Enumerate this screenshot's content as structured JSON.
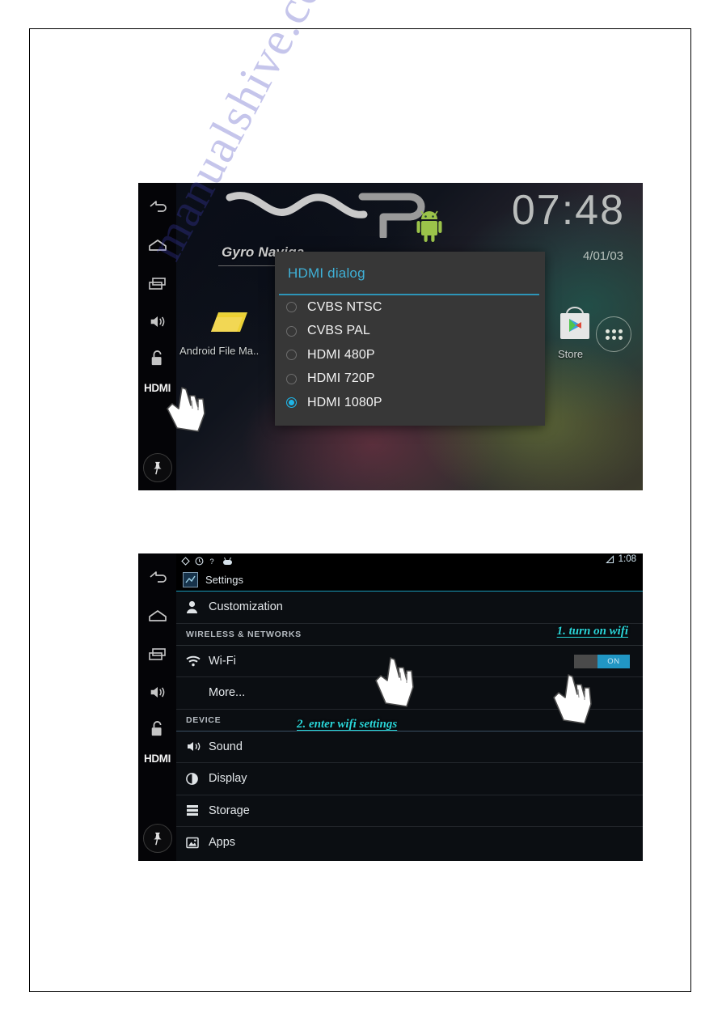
{
  "watermark": {
    "text": "manualshive.com"
  },
  "screenshot_home": {
    "name": "android-home-screen-with-hdmi-dialog",
    "nav_rail": {
      "items": [
        {
          "name": "back",
          "icon": "back-arrow-icon"
        },
        {
          "name": "home",
          "icon": "home-icon"
        },
        {
          "name": "recents",
          "icon": "recents-icon"
        },
        {
          "name": "volume",
          "icon": "volume-icon"
        },
        {
          "name": "lock",
          "icon": "unlock-icon"
        },
        {
          "name": "hdmi",
          "label": "HDMI"
        },
        {
          "name": "pin",
          "icon": "pin-icon"
        }
      ]
    },
    "brand_logo": "WP",
    "widget_title": "Gyro Naviga",
    "clock": "07:48",
    "date": "4/01/03",
    "apps": [
      {
        "label": "Android File Ma..",
        "icon": "file-manager-icon"
      },
      {
        "label": "Store",
        "icon": "play-store-icon"
      }
    ],
    "drawer_button": "app-drawer-icon",
    "dialog": {
      "title": "HDMI dialog",
      "options": [
        {
          "label": "CVBS NTSC",
          "selected": false
        },
        {
          "label": "CVBS PAL",
          "selected": false
        },
        {
          "label": "HDMI 480P",
          "selected": false
        },
        {
          "label": "HDMI 720P",
          "selected": false
        },
        {
          "label": "HDMI 1080P",
          "selected": true
        }
      ],
      "accent_color": "#2d95b8",
      "title_color": "#3fb0d6",
      "selected_color": "#1fb6e8"
    }
  },
  "screenshot_settings": {
    "name": "android-settings-screen-wifi",
    "nav_rail": {
      "items": [
        {
          "name": "back",
          "icon": "back-arrow-icon"
        },
        {
          "name": "home",
          "icon": "home-icon"
        },
        {
          "name": "recents",
          "icon": "recents-icon"
        },
        {
          "name": "volume",
          "icon": "volume-icon"
        },
        {
          "name": "lock",
          "icon": "unlock-icon"
        },
        {
          "name": "hdmi",
          "label": "HDMI"
        },
        {
          "name": "pin",
          "icon": "pin-icon"
        }
      ]
    },
    "statusbar": {
      "icons": [
        "diamond-icon",
        "clock-icon",
        "help-icon",
        "android-icon"
      ],
      "signal_icon": "signal-triangle-icon",
      "time": "1:08"
    },
    "titlebar": {
      "title": "Settings",
      "icon": "settings-app-icon"
    },
    "rows": [
      {
        "label": "Customization",
        "icon": "person-icon",
        "type": "item"
      },
      {
        "label": "WIRELESS & NETWORKS",
        "type": "header"
      },
      {
        "label": "Wi-Fi",
        "icon": "wifi-icon",
        "type": "item",
        "toggle": "ON"
      },
      {
        "label": "More...",
        "type": "item-indent"
      },
      {
        "label": "DEVICE",
        "type": "header"
      },
      {
        "label": "Sound",
        "icon": "sound-icon",
        "type": "item"
      },
      {
        "label": "Display",
        "icon": "display-icon",
        "type": "item"
      },
      {
        "label": "Storage",
        "icon": "storage-icon",
        "type": "item"
      },
      {
        "label": "Apps",
        "icon": "apps-icon",
        "type": "item"
      }
    ],
    "toggle_on_label": "ON",
    "toggle_on_color": "#2196c4",
    "annotations": [
      {
        "id": "anno1",
        "text": "1. turn on wifi"
      },
      {
        "id": "anno2",
        "text": "2. enter wifi settings"
      }
    ],
    "annotation_color": "#2ad5d8"
  }
}
